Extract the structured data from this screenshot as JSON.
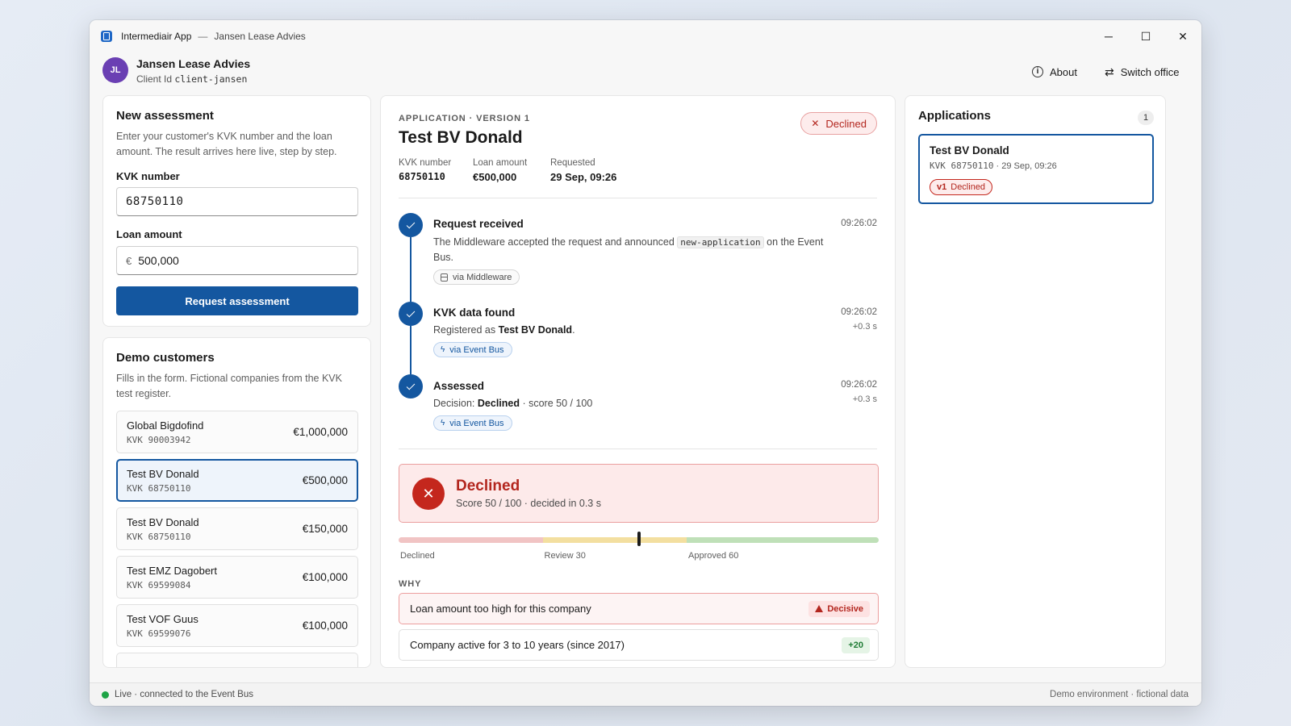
{
  "window": {
    "app_name": "Intermediair App",
    "separator": "—",
    "office_title": "Jansen Lease Advies",
    "controls": {
      "minimize": "─",
      "maximize": "☐",
      "close": "✕"
    }
  },
  "header": {
    "avatar_initials": "JL",
    "office_name": "Jansen Lease Advies",
    "client_id_label": "Client Id",
    "client_id_value": "client-jansen",
    "about_label": "About",
    "switch_label": "Switch office",
    "switch_icon": "⇄"
  },
  "new_assessment": {
    "title": "New assessment",
    "description": "Enter your customer's KVK number and the loan amount. The result arrives here live, step by step.",
    "kvk_label": "KVK number",
    "kvk_value": "68750110",
    "loan_label": "Loan amount",
    "currency_symbol": "€",
    "loan_value": "500,000",
    "submit_label": "Request assessment"
  },
  "demo_customers": {
    "title": "Demo customers",
    "description": "Fills in the form. Fictional companies from the KVK test register.",
    "items": [
      {
        "name": "Global Bigdofind",
        "kvk": "KVK 90003942",
        "amount": "€1,000,000"
      },
      {
        "name": "Test BV Donald",
        "kvk": "KVK 68750110",
        "amount": "€500,000"
      },
      {
        "name": "Test BV Donald",
        "kvk": "KVK 68750110",
        "amount": "€150,000"
      },
      {
        "name": "Test EMZ Dagobert",
        "kvk": "KVK 69599084",
        "amount": "€100,000"
      },
      {
        "name": "Test VOF Guus",
        "kvk": "KVK 69599076",
        "amount": "€100,000"
      }
    ]
  },
  "application": {
    "eyebrow": "APPLICATION · VERSION 1",
    "title": "Test BV Donald",
    "status_label": "Declined",
    "status_icon": "✕",
    "meta": {
      "kvk_label": "KVK number",
      "kvk_value": "68750110",
      "loan_label": "Loan amount",
      "loan_value": "€500,000",
      "requested_label": "Requested",
      "requested_value": "29 Sep, 09:26"
    },
    "timeline": {
      "step1": {
        "title": "Request received",
        "body_before": "The Middleware accepted the request and announced ",
        "body_code": "new-application",
        "body_after": " on the Event Bus.",
        "time": "09:26:02",
        "chip": "via Middleware"
      },
      "step2": {
        "title": "KVK data found",
        "body_before": "Registered as ",
        "body_bold": "Test BV Donald",
        "body_after": ".",
        "time": "09:26:02",
        "delta": "+0.3 s",
        "chip": "via Event Bus"
      },
      "step3": {
        "title": "Assessed",
        "body_before": "Decision: ",
        "body_bold": "Declined",
        "body_after": " · score 50 / 100",
        "time": "09:26:02",
        "delta": "+0.3 s",
        "chip": "via Event Bus"
      }
    },
    "result": {
      "icon": "✕",
      "title": "Declined",
      "subtitle": "Score 50 / 100 · decided in 0.3 s"
    },
    "score": {
      "value": 50,
      "max": 100,
      "labels": {
        "declined": "Declined",
        "review": "Review 30",
        "approved": "Approved 60"
      },
      "colors": {
        "declined": "#f1c4c4",
        "review": "#f3dfa0",
        "approved": "#bfe0b8"
      }
    },
    "why_label": "WHY",
    "reasons": [
      {
        "text": "Loan amount too high for this company",
        "badge": "Decisive"
      },
      {
        "text": "Company active for 3 to 10 years (since 2017)",
        "badge": "+20"
      }
    ]
  },
  "applications_panel": {
    "title": "Applications",
    "count": "1",
    "item": {
      "name": "Test BV Donald",
      "kvk": "KVK 68750110",
      "sep": " · ",
      "date": "29 Sep, 09:26",
      "version": "v1",
      "status": "Declined"
    }
  },
  "statusbar": {
    "live_text": "Live · connected to the Event Bus",
    "environment": "Demo environment · fictional data"
  },
  "colors": {
    "accent": "#1457a0",
    "danger": "#b3261e",
    "success": "#1ea446"
  }
}
